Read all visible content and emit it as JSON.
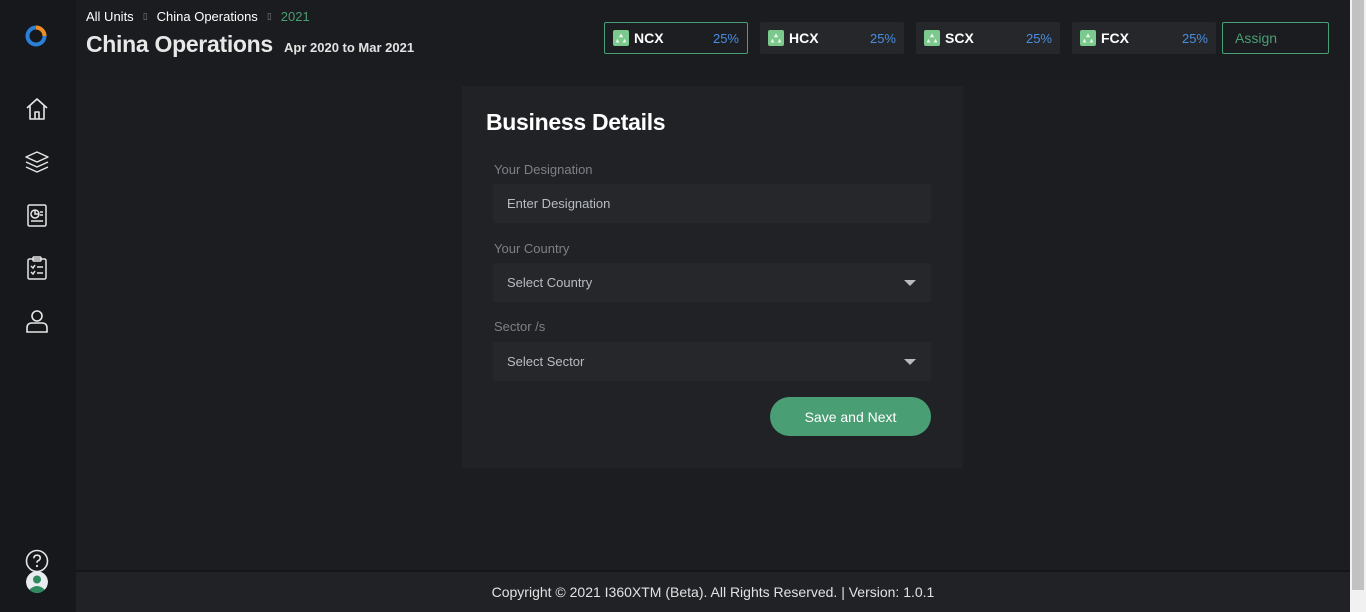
{
  "sidebar": {
    "logo": "app-logo",
    "items": [
      {
        "name": "home",
        "icon": "home-icon"
      },
      {
        "name": "layers",
        "icon": "layers-icon"
      },
      {
        "name": "report",
        "icon": "report-icon"
      },
      {
        "name": "checklist",
        "icon": "checklist-icon"
      },
      {
        "name": "profile",
        "icon": "user-icon"
      }
    ],
    "help_icon": "question-icon"
  },
  "header": {
    "breadcrumb": [
      "All Units",
      "China Operations",
      "2021"
    ],
    "title": "China Operations",
    "period": "Apr 2020 to Mar 2021",
    "metrics": [
      {
        "label": "NCX",
        "value": "25%"
      },
      {
        "label": "HCX",
        "value": "25%"
      },
      {
        "label": "SCX",
        "value": "25%"
      },
      {
        "label": "FCX",
        "value": "25%"
      }
    ],
    "assign_label": "Assign"
  },
  "form": {
    "title": "Business Details",
    "designation_label": "Your Designation",
    "designation_placeholder": "Enter Designation",
    "country_label": "Your Country",
    "country_value": "Select Country",
    "sector_label": "Sector /s",
    "sector_value": "Select Sector",
    "save_label": "Save and Next"
  },
  "footer": {
    "text": "Copyright © 2021 I360XTM (Beta). All Rights Reserved. | Version: 1.0.1"
  },
  "colors": {
    "accent": "#4a9e74",
    "value_blue": "#4a8ee0",
    "background": "#1b1d20"
  }
}
